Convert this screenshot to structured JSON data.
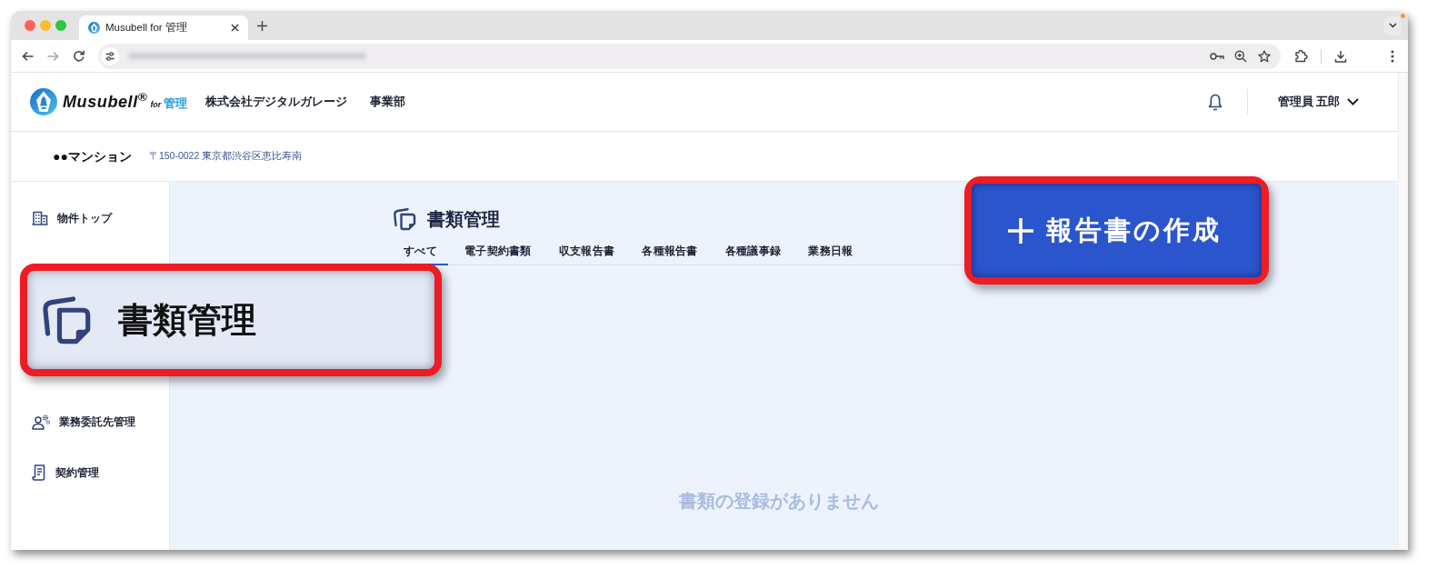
{
  "browser": {
    "tabs": [
      {
        "title": "Musubell for 管理",
        "selected": true
      }
    ]
  },
  "header": {
    "logo": {
      "brand": "Musubell$^{®}$",
      "for": "for",
      "product": "管理"
    },
    "company": "株式会社デジタルガレージ",
    "department": "事業部",
    "user": "管理員 五郎"
  },
  "property": {
    "name": "●●マンション",
    "address": "〒150-0022 東京都渋谷区恵比寿南"
  },
  "sidebar": {
    "items": [
      {
        "label": "物件トップ",
        "selected": false
      },
      {
        "label": "業務委託先管理",
        "selected": false
      },
      {
        "label": "契約管理",
        "selected": false
      }
    ]
  },
  "page": {
    "title": "書類管理",
    "tabs": [
      {
        "label": "すべて",
        "selected": true
      },
      {
        "label": "電子契約書類",
        "selected": false
      },
      {
        "label": "収支報告書",
        "selected": false
      },
      {
        "label": "各種報告書",
        "selected": false
      },
      {
        "label": "各種議事録",
        "selected": false
      },
      {
        "label": "業務日報",
        "selected": false
      }
    ],
    "empty_message": "書類の登録がありません"
  },
  "callouts": [
    {
      "kind": "menu_item",
      "label": "書類管理"
    },
    {
      "kind": "button",
      "label": "報告書の作成"
    }
  ]
}
